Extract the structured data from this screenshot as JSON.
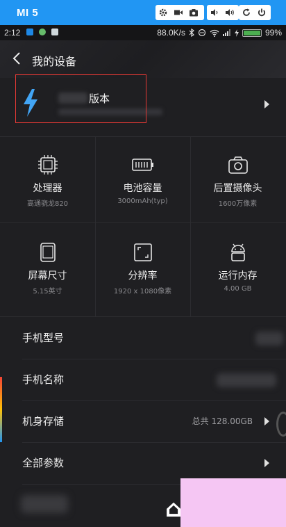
{
  "emulator": {
    "device_name": "MI 5",
    "buttons": [
      "settings-icon",
      "video-icon",
      "camera-icon",
      "volume-down-icon",
      "volume-up-icon",
      "rotate-icon",
      "power-icon"
    ]
  },
  "status_bar": {
    "time": "2:12",
    "net_speed": "88.0K/s",
    "battery_percent": "99%",
    "battery_level": 0.99,
    "battery_color": "#4caf50"
  },
  "header": {
    "title": "我的设备"
  },
  "version_card": {
    "label": "版本"
  },
  "specs": [
    {
      "label": "处理器",
      "sub": "高通骁龙820",
      "icon": "cpu-icon"
    },
    {
      "label": "电池容量",
      "sub": "3000mAh(typ)",
      "icon": "battery-icon"
    },
    {
      "label": "后置摄像头",
      "sub": "1600万像素",
      "icon": "camera-icon"
    },
    {
      "label": "屏幕尺寸",
      "sub": "5.15英寸",
      "icon": "screen-icon"
    },
    {
      "label": "分辨率",
      "sub": "1920 x 1080像素",
      "icon": "resolution-icon"
    },
    {
      "label": "运行内存",
      "sub": "4.00 GB",
      "icon": "android-icon"
    }
  ],
  "rows": [
    {
      "label": "手机型号",
      "value": ""
    },
    {
      "label": "手机名称",
      "value": ""
    },
    {
      "label": "机身存储",
      "value": "总共 128.00GB"
    },
    {
      "label": "全部参数",
      "value": ""
    }
  ],
  "colors": {
    "accent": "#2196f3",
    "highlight": "#e53935",
    "bolt": "#42a5f5",
    "background": "#1f1f22"
  }
}
